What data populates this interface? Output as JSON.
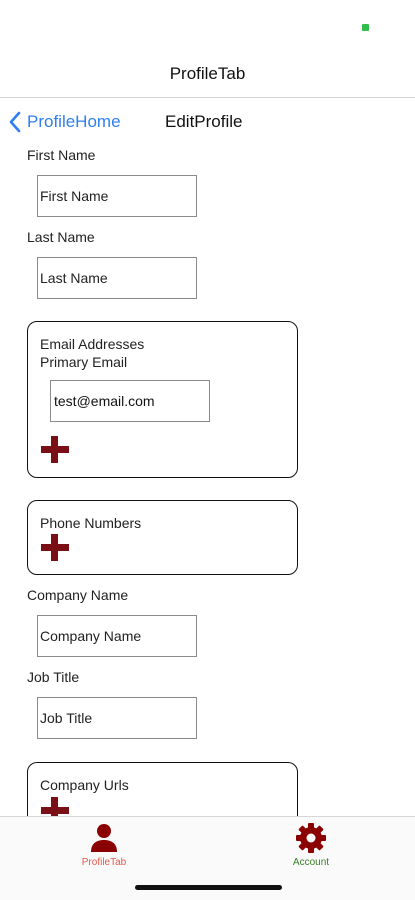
{
  "app": {
    "tab_header_title": "ProfileTab",
    "back_label": "ProfileHome",
    "screen_title": "EditProfile"
  },
  "form": {
    "first_name": {
      "label": "First Name",
      "placeholder": "First Name",
      "value": ""
    },
    "last_name": {
      "label": "Last Name",
      "placeholder": "Last Name",
      "value": ""
    },
    "email_group": {
      "title": "Email Addresses",
      "primary_label": "Primary Email",
      "primary_value": "test@email.com"
    },
    "phone_group": {
      "title": "Phone Numbers"
    },
    "company_name": {
      "label": "Company Name",
      "placeholder": "Company Name",
      "value": ""
    },
    "job_title": {
      "label": "Job Title",
      "placeholder": "Job Title",
      "value": ""
    },
    "company_urls_group": {
      "title": "Company Urls"
    }
  },
  "tab_bar": {
    "items": [
      {
        "label": "ProfileTab",
        "icon": "person-icon",
        "color": "#8b0000",
        "label_color": "#e05a4f"
      },
      {
        "label": "Account",
        "icon": "gear-icon",
        "color": "#8b0000",
        "label_color": "#3a7d2a"
      }
    ]
  },
  "colors": {
    "accent_link": "#2f7ff2",
    "add_icon": "#7a0f16",
    "status_indicator": "#2fbf4a"
  }
}
